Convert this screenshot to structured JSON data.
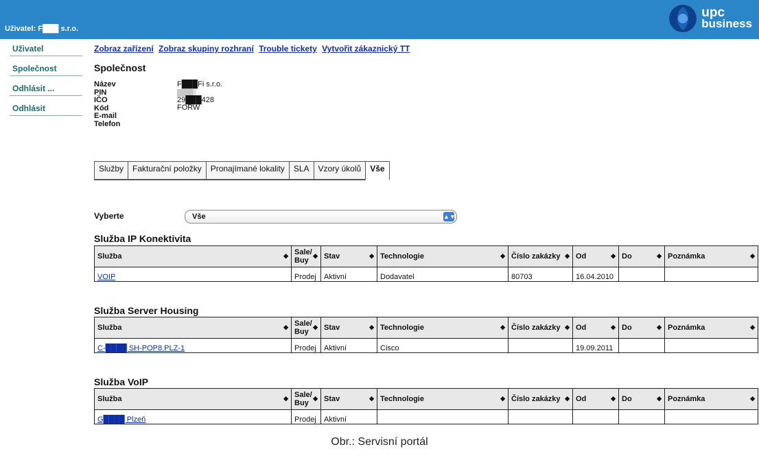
{
  "header": {
    "user_label": "Uživatel: F███ s.r.o.",
    "logo_line1": "upc",
    "logo_line2": "business"
  },
  "sidebar": {
    "items": [
      {
        "label": "Uživatel"
      },
      {
        "label": "Společnost"
      },
      {
        "label": "Odhlásit ..."
      },
      {
        "label": "Odhlásit"
      }
    ]
  },
  "toplinks": [
    {
      "label": "Zobraz zařízení"
    },
    {
      "label": "Zobraz skupiny rozhraní"
    },
    {
      "label": "Trouble tickety"
    },
    {
      "label": "Vytvořit zákaznický TT"
    }
  ],
  "company": {
    "title": "Společnost",
    "labels": [
      "Název",
      "PIN",
      "IČO",
      "Kód",
      "E-mail",
      "Telefon"
    ],
    "values": [
      "F███Fi s.r.o.",
      "███",
      "29███428",
      "FORW",
      "",
      ""
    ]
  },
  "tabs": [
    {
      "label": "Služby"
    },
    {
      "label": "Fakturační položky"
    },
    {
      "label": "Pronajímané lokality"
    },
    {
      "label": "SLA"
    },
    {
      "label": "Vzory úkolů"
    },
    {
      "label": "Vše",
      "active": true
    }
  ],
  "filter": {
    "label": "Vyberte",
    "value": "Vše"
  },
  "columns": [
    "Služba",
    "Sale/ Buy",
    "Stav",
    "Technologie",
    "Číslo zakázky",
    "Od",
    "Do",
    "Poznámka"
  ],
  "sections": [
    {
      "title": "Služba IP Konektivita",
      "row": {
        "sluzba": "VOIP",
        "sale": "Prodej",
        "stav": "Aktivní",
        "tech": "Dodavatel",
        "cislo": "80703",
        "od": "16.04.2010",
        "do": "",
        "pozn": ""
      }
    },
    {
      "title": "Služba Server Housing",
      "row": {
        "sluzba": "C-████ SH-POP8.PLZ-1",
        "sale": "Prodej",
        "stav": "Aktivní",
        "tech": "Cisco",
        "cislo": "",
        "od": "19.09.2011",
        "do": "",
        "pozn": ""
      }
    },
    {
      "title": "Služba VoIP",
      "row": {
        "sluzba": "G████ Plzeň",
        "sale": "Prodej",
        "stav": "Aktivní",
        "tech": "",
        "cislo": "",
        "od": "",
        "do": "",
        "pozn": ""
      }
    }
  ],
  "caption": "Obr.: Servisní portál",
  "colors": {
    "header_bg": "#2a86c9",
    "link": "#0e2fa8",
    "sidebar_text": "#1d6a6b"
  }
}
